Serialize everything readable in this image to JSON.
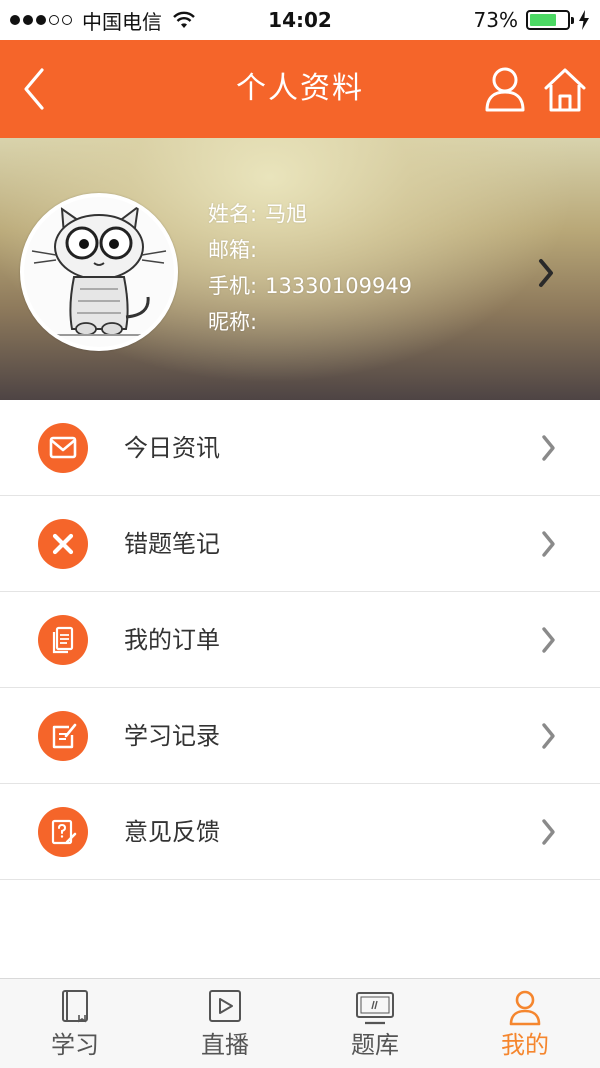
{
  "status_bar": {
    "carrier": "中国电信",
    "time": "14:02",
    "battery_percent": "73%",
    "battery_level": 0.73
  },
  "nav": {
    "title": "个人资料",
    "back_icon": "chevron-left-icon",
    "user_icon": "user-icon",
    "home_icon": "home-icon"
  },
  "profile": {
    "rows": [
      {
        "label": "姓名:",
        "value": "马旭"
      },
      {
        "label": "邮箱:",
        "value": ""
      },
      {
        "label": "手机:",
        "value": "13330109949"
      },
      {
        "label": "昵称:",
        "value": ""
      }
    ]
  },
  "menu": {
    "items": [
      {
        "label": "今日资讯",
        "icon": "mail-icon"
      },
      {
        "label": "错题笔记",
        "icon": "close-icon"
      },
      {
        "label": "我的订单",
        "icon": "document-icon"
      },
      {
        "label": "学习记录",
        "icon": "edit-icon"
      },
      {
        "label": "意见反馈",
        "icon": "feedback-icon"
      }
    ]
  },
  "tabs": {
    "items": [
      {
        "label": "学习",
        "icon": "book-icon",
        "active": false
      },
      {
        "label": "直播",
        "icon": "play-icon",
        "active": false
      },
      {
        "label": "题库",
        "icon": "monitor-icon",
        "active": false
      },
      {
        "label": "我的",
        "icon": "user-icon",
        "active": true
      }
    ]
  },
  "colors": {
    "accent": "#f5652a",
    "tab_active": "#f5862e",
    "battery": "#4cd964"
  }
}
